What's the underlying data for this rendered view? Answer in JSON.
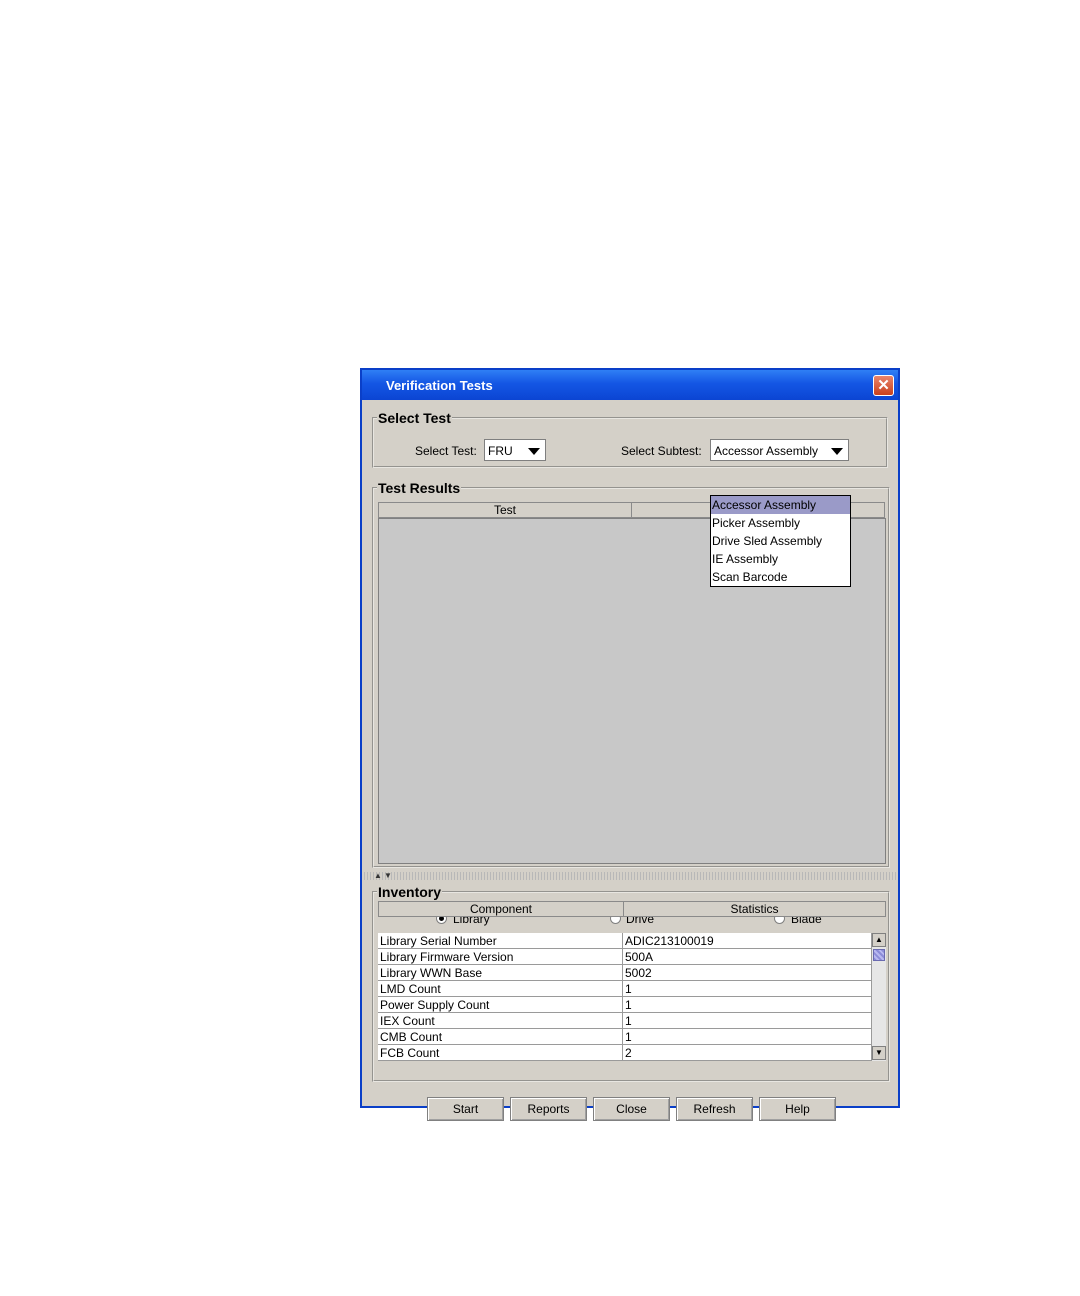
{
  "window": {
    "title": "Verification Tests"
  },
  "select_test": {
    "group_label": "Select Test",
    "test_label": "Select Test:",
    "test_value": "FRU",
    "subtest_label": "Select Subtest:",
    "subtest_value": "Accessor Assembly",
    "subtest_options": [
      "Accessor Assembly",
      "Picker Assembly",
      "Drive Sled Assembly",
      "IE Assembly",
      "Scan Barcode"
    ],
    "subtest_selected_index": 0
  },
  "test_results": {
    "group_label": "Test Results",
    "columns": [
      "Test",
      ""
    ]
  },
  "inventory": {
    "group_label": "Inventory",
    "radio_options": [
      "Library",
      "Drive",
      "Blade"
    ],
    "radio_selected": "Library",
    "columns": [
      "Component",
      "Statistics"
    ],
    "rows": [
      [
        "Library Serial Number",
        "ADIC213100019"
      ],
      [
        "Library Firmware Version",
        "500A"
      ],
      [
        "Library WWN Base",
        "5002"
      ],
      [
        "LMD Count",
        "1"
      ],
      [
        "Power Supply Count",
        "1"
      ],
      [
        "IEX Count",
        "1"
      ],
      [
        "CMB Count",
        "1"
      ],
      [
        "FCB Count",
        "2"
      ]
    ]
  },
  "buttons": {
    "start": "Start",
    "reports": "Reports",
    "close": "Close",
    "refresh": "Refresh",
    "help": "Help"
  },
  "colors": {
    "titlebar": "#0b45d3",
    "dialog_bg": "#d4d0c8",
    "dropdown_selected": "#9a9ac8"
  }
}
